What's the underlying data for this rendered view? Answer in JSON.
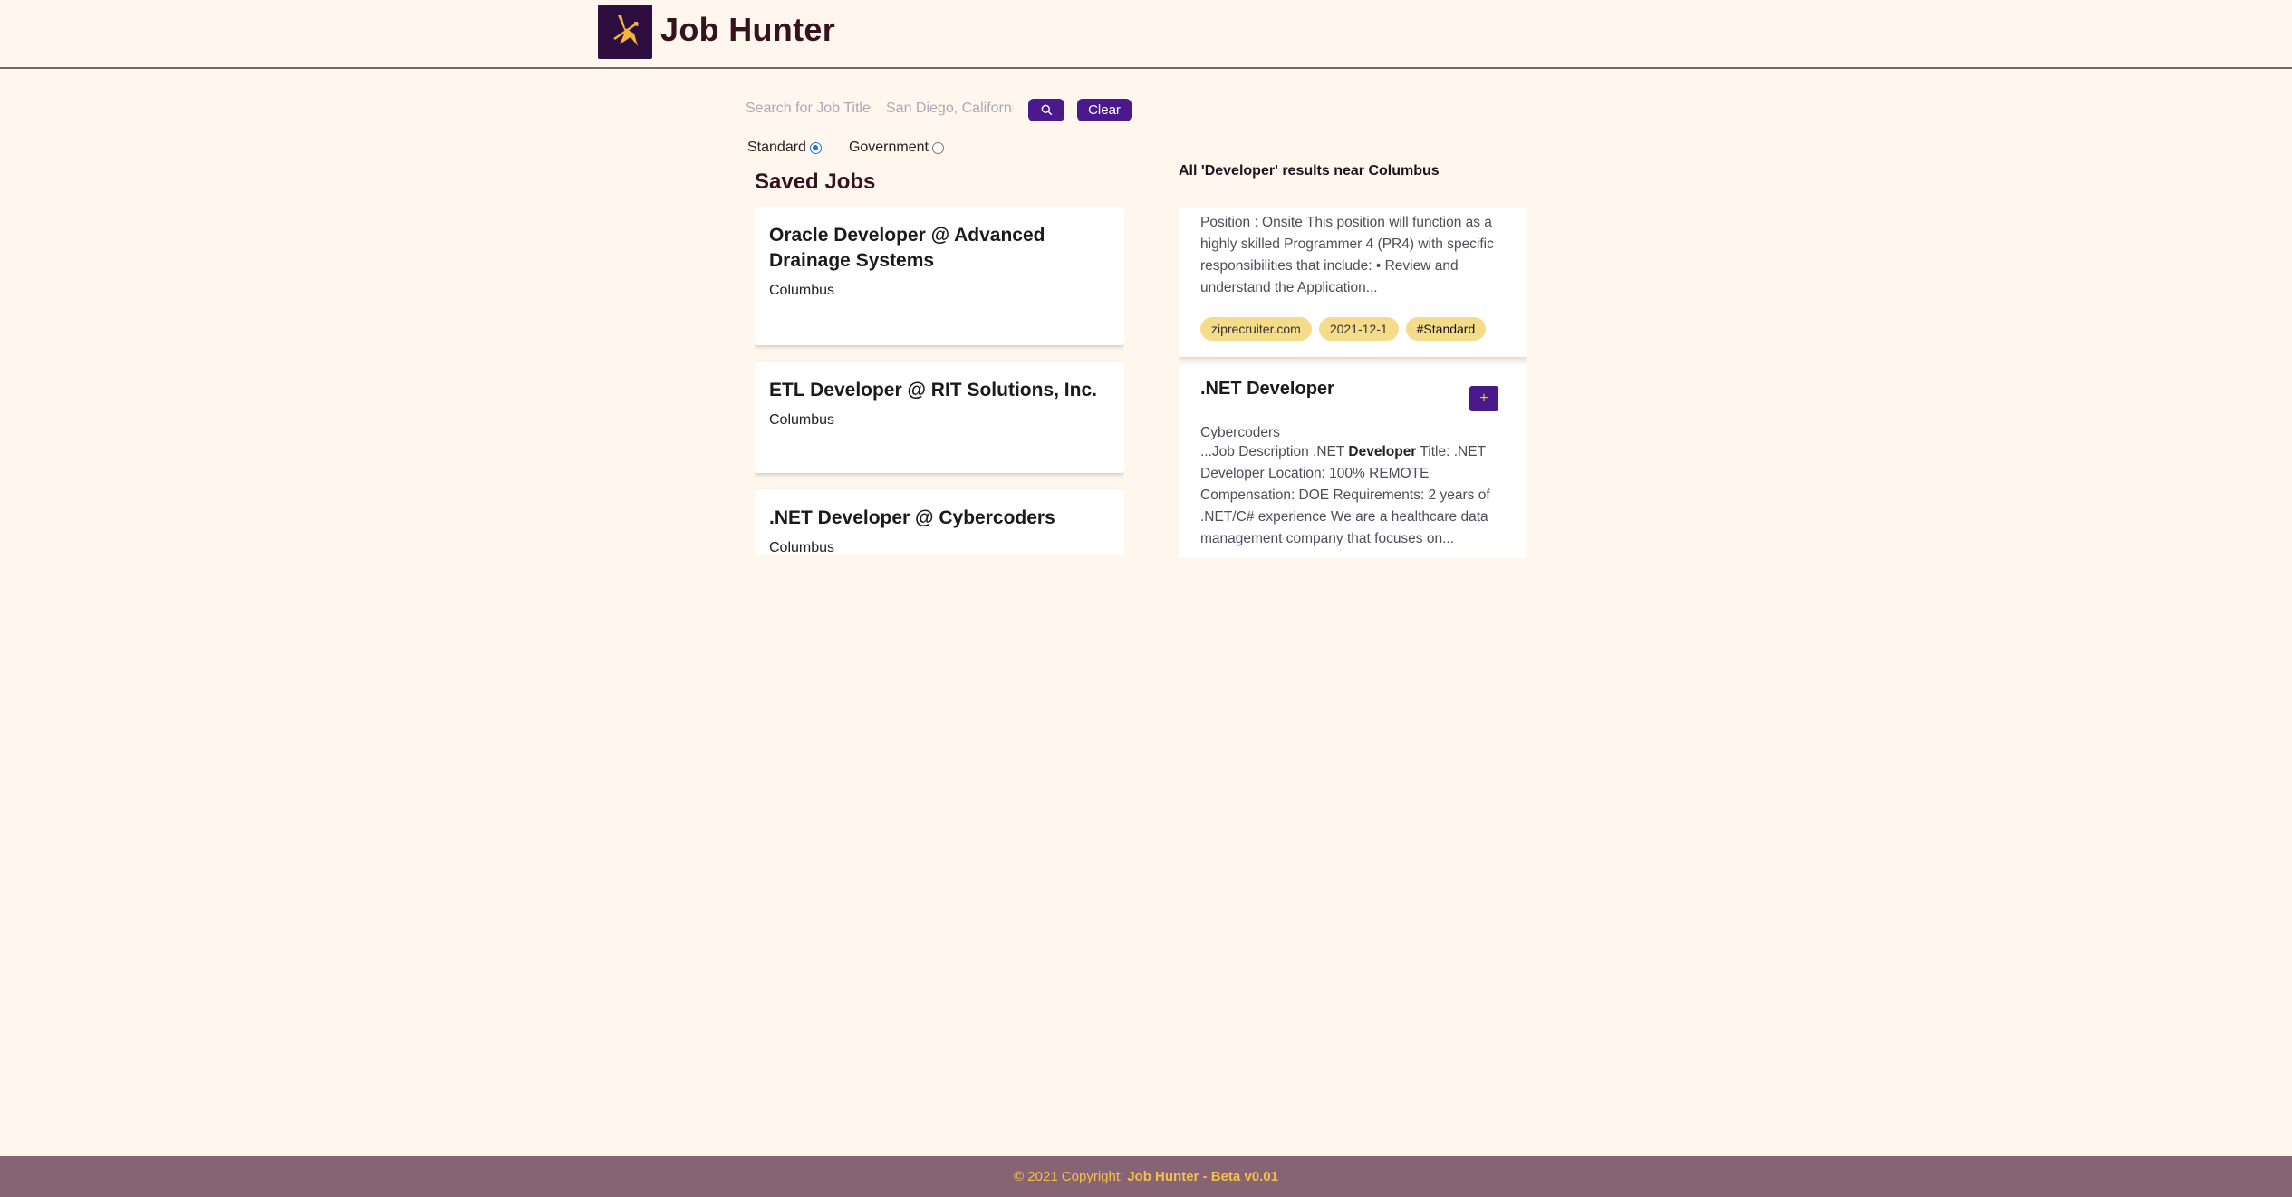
{
  "brand": {
    "name": "Job Hunter",
    "logo_icon": "hunter-logo-icon"
  },
  "search": {
    "job_placeholder": "Search for Job Titles",
    "location_placeholder": "San Diego, California",
    "search_icon": "search-icon",
    "clear_label": "Clear"
  },
  "filters": {
    "options": [
      {
        "label": "Standard",
        "selected": true
      },
      {
        "label": "Government",
        "selected": false
      }
    ]
  },
  "saved": {
    "title": "Saved Jobs",
    "items": [
      {
        "title": "Oracle Developer @ Advanced Drainage Systems",
        "location": "Columbus"
      },
      {
        "title": "ETL Developer @ RIT Solutions, Inc.",
        "location": "Columbus"
      },
      {
        "title": ".NET Developer @ Cybercoders",
        "location": "Columbus"
      }
    ]
  },
  "results": {
    "heading": "All 'Developer' results near Columbus",
    "items": [
      {
        "description": "Position : Onsite This position will function as a highly skilled Programmer 4 (PR4) with specific responsibilities that include: • Review and understand the Application...",
        "tags": [
          "ziprecruiter.com",
          "2021-12-1",
          "#Standard"
        ]
      },
      {
        "title": ".NET Developer",
        "add_label": "+",
        "company": "Cybercoders",
        "snippet_pre": "...Job Description .NET ",
        "snippet_bold": "Developer",
        "snippet_post": " Title: .NET Developer Location: 100% REMOTE Compensation: DOE Requirements: 2 years of .NET/C# experience We are a healthcare data management company that focuses on..."
      }
    ]
  },
  "footer": {
    "copyright": "© 2021 Copyright:",
    "product": "Job Hunter - Beta v0.01"
  },
  "colors": {
    "background": "#fff6ee",
    "accent_purple": "#4a1a8c",
    "tag_yellow": "#f5dc8a",
    "footer_bg": "#876473",
    "footer_text": "#f5c04a"
  }
}
